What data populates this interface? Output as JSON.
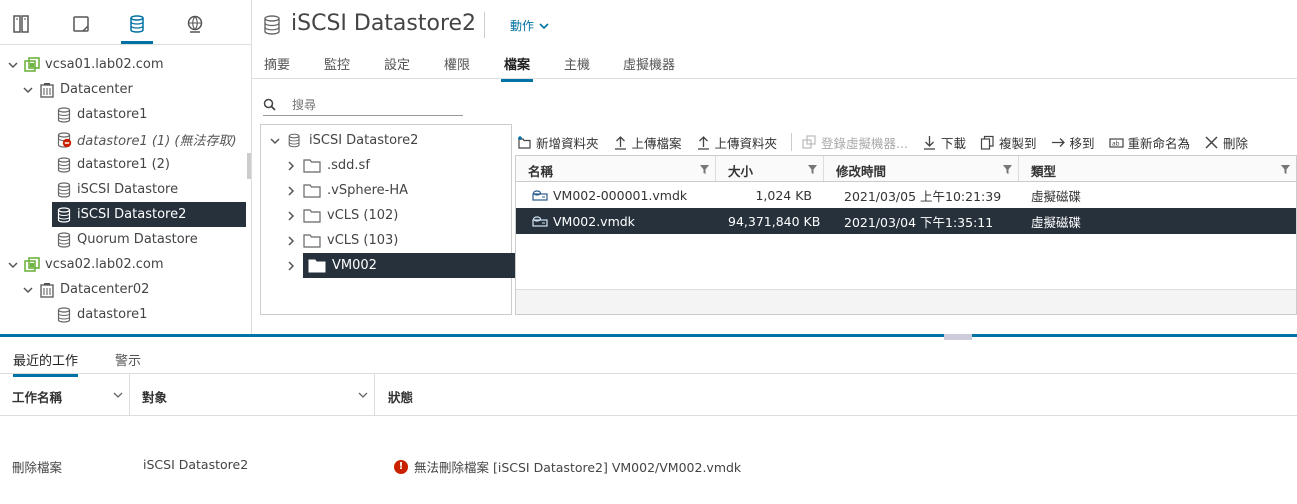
{
  "navigator": {
    "tabs": [
      {
        "icon": "hosts-clusters-icon"
      },
      {
        "icon": "vms-templates-icon"
      },
      {
        "icon": "storage-icon"
      },
      {
        "icon": "networking-icon"
      }
    ],
    "tree": [
      {
        "label": "vcsa01.lab02.com",
        "icon": "vcenter-icon",
        "expanded": true
      },
      {
        "label": "Datacenter",
        "icon": "datacenter-icon",
        "expanded": true
      },
      {
        "label": "datastore1",
        "icon": "datastore-icon"
      },
      {
        "label": "datastore1 (1) (無法存取)",
        "icon": "datastore-error-icon"
      },
      {
        "label": "datastore1 (2)",
        "icon": "datastore-icon"
      },
      {
        "label": "iSCSI Datastore",
        "icon": "datastore-icon"
      },
      {
        "label": "iSCSI Datastore2",
        "icon": "datastore-icon",
        "selected": true
      },
      {
        "label": "Quorum Datastore",
        "icon": "datastore-icon"
      },
      {
        "label": "vcsa02.lab02.com",
        "icon": "vcenter-icon",
        "expanded": true
      },
      {
        "label": "Datacenter02",
        "icon": "datacenter-icon",
        "expanded": true
      },
      {
        "label": "datastore1",
        "icon": "datastore-icon"
      }
    ]
  },
  "header": {
    "title": "iSCSI Datastore2",
    "actions_label": "動作",
    "tabs": [
      "摘要",
      "監控",
      "設定",
      "權限",
      "檔案",
      "主機",
      "虛擬機器"
    ],
    "active_tab": "檔案"
  },
  "search": {
    "placeholder": "搜尋",
    "value": ""
  },
  "folder_tree": [
    {
      "label": "iSCSI Datastore2",
      "expanded": true,
      "icon": "datastore-icon"
    },
    {
      "label": ".sdd.sf",
      "icon": "folder-icon"
    },
    {
      "label": ".vSphere-HA",
      "icon": "folder-icon"
    },
    {
      "label": "vCLS (102)",
      "icon": "folder-icon"
    },
    {
      "label": "vCLS (103)",
      "icon": "folder-icon"
    },
    {
      "label": "VM002",
      "icon": "folder-icon",
      "selected": true
    }
  ],
  "toolbar": {
    "new_folder": "新增資料夾",
    "upload_files": "上傳檔案",
    "upload_folder": "上傳資料夾",
    "register_vm": "登錄虛擬機器...",
    "download": "下載",
    "copy_to": "複製到",
    "move_to": "移到",
    "rename_to": "重新命名為",
    "delete": "刪除"
  },
  "grid": {
    "columns": [
      "名稱",
      "大小",
      "修改時間",
      "類型"
    ],
    "rows": [
      {
        "name": "VM002-000001.vmdk",
        "size": "1,024 KB",
        "modified": "2021/03/05 上午10:21:39",
        "type": "虛擬磁碟"
      },
      {
        "name": "VM002.vmdk",
        "size": "94,371,840 KB",
        "modified": "2021/03/04 下午1:35:11",
        "type": "虛擬磁碟",
        "selected": true
      }
    ]
  },
  "recent_tasks": {
    "tabs": [
      "最近的工作",
      "警示"
    ],
    "active_tab": "最近的工作",
    "columns": [
      "工作名稱",
      "對象",
      "狀態"
    ],
    "rows": [
      {
        "task": "刪除檔案",
        "target": "iSCSI Datastore2",
        "status": "無法刪除檔案 [iSCSI Datastore2] VM002/VM002.vmdk",
        "status_level": "error"
      }
    ]
  },
  "colors": {
    "accent": "#0072a3",
    "selected_bg": "#26313b",
    "error": "#c92100",
    "vcenter_green": "#6db33f"
  }
}
